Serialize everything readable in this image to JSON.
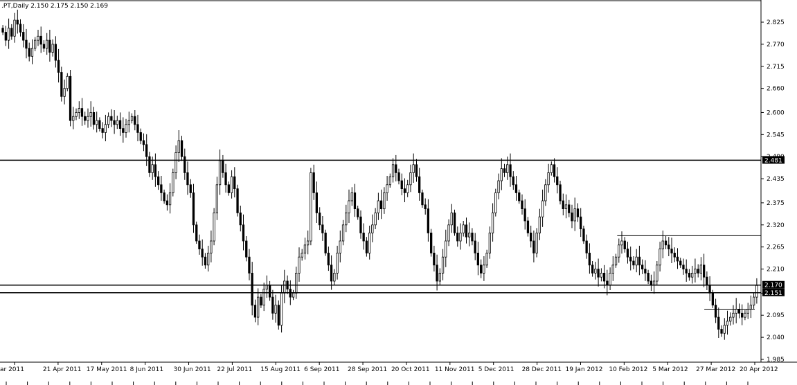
{
  "window": {
    "title": ".PT,Daily  2.150 2.175 2.150 2.169"
  },
  "colors": {
    "background": "#ffffff",
    "candle": "#000000",
    "axis": "#000000",
    "priceTagBackground": "#000000",
    "priceTagText": "#ffffff"
  },
  "chart_data": {
    "type": "candlestick",
    "title": ".PT,Daily",
    "ohlc_header": "2.150 2.175 2.150 2.169",
    "last": {
      "open": 2.15,
      "high": 2.175,
      "low": 2.15,
      "close": 2.169
    },
    "ylim": [
      1.975,
      2.87
    ],
    "y_ticks": [
      "2.825",
      "2.770",
      "2.715",
      "2.660",
      "2.600",
      "2.545",
      "2.490",
      "2.435",
      "2.375",
      "2.320",
      "2.265",
      "2.210",
      "2.150",
      "2.095",
      "2.040",
      "1.985"
    ],
    "x_labels": [
      "ar 2011",
      "21 Apr 2011",
      "17 May 2011",
      "8 Jun 2011",
      "30 Jun 2011",
      "22 Jul 2011",
      "15 Aug 2011",
      "6 Sep 2011",
      "28 Sep 2011",
      "20 Oct 2011",
      "11 Nov 2011",
      "5 Dec 2011",
      "28 Dec 2011",
      "19 Jan 2012",
      "10 Feb 2012",
      "5 Mar 2012",
      "27 Mar 2012",
      "20 Apr 2012"
    ],
    "horizontal_lines": [
      {
        "price": 2.481,
        "label": "2.481",
        "tagged": true
      },
      {
        "price": 2.17,
        "label": "2.170",
        "tagged": true
      },
      {
        "price": 2.151,
        "label": "2.151",
        "tagged": true
      },
      {
        "price": 2.293,
        "label": "",
        "tagged": false,
        "start_date": "10 Feb 2012"
      },
      {
        "price": 2.11,
        "label": "",
        "tagged": false,
        "start_date": "27 Mar 2012",
        "end_date": "20 Apr 2012"
      }
    ],
    "closes": [
      2.8,
      2.78,
      2.81,
      2.79,
      2.83,
      2.82,
      2.8,
      2.78,
      2.76,
      2.74,
      2.76,
      2.78,
      2.79,
      2.77,
      2.76,
      2.78,
      2.75,
      2.77,
      2.73,
      2.7,
      2.64,
      2.66,
      2.69,
      2.58,
      2.59,
      2.6,
      2.61,
      2.59,
      2.58,
      2.59,
      2.6,
      2.57,
      2.58,
      2.56,
      2.55,
      2.57,
      2.59,
      2.58,
      2.57,
      2.58,
      2.56,
      2.55,
      2.57,
      2.58,
      2.59,
      2.57,
      2.55,
      2.53,
      2.52,
      2.49,
      2.45,
      2.47,
      2.44,
      2.42,
      2.4,
      2.38,
      2.37,
      2.4,
      2.45,
      2.5,
      2.53,
      2.49,
      2.45,
      2.42,
      2.4,
      2.32,
      2.28,
      2.26,
      2.24,
      2.22,
      2.25,
      2.28,
      2.35,
      2.42,
      2.48,
      2.45,
      2.42,
      2.4,
      2.44,
      2.41,
      2.35,
      2.32,
      2.28,
      2.24,
      2.2,
      2.12,
      2.09,
      2.14,
      2.12,
      2.16,
      2.17,
      2.14,
      2.1,
      2.12,
      2.07,
      2.15,
      2.18,
      2.16,
      2.14,
      2.15,
      2.2,
      2.24,
      2.25,
      2.27,
      2.28,
      2.45,
      2.4,
      2.35,
      2.32,
      2.3,
      2.25,
      2.22,
      2.18,
      2.2,
      2.25,
      2.28,
      2.32,
      2.35,
      2.38,
      2.4,
      2.36,
      2.34,
      2.3,
      2.28,
      2.25,
      2.3,
      2.32,
      2.35,
      2.38,
      2.36,
      2.4,
      2.42,
      2.44,
      2.47,
      2.45,
      2.43,
      2.41,
      2.4,
      2.42,
      2.45,
      2.47,
      2.44,
      2.4,
      2.37,
      2.36,
      2.3,
      2.25,
      2.22,
      2.18,
      2.2,
      2.24,
      2.28,
      2.32,
      2.35,
      2.3,
      2.28,
      2.3,
      2.32,
      2.29,
      2.3,
      2.28,
      2.25,
      2.22,
      2.2,
      2.22,
      2.25,
      2.3,
      2.35,
      2.4,
      2.43,
      2.46,
      2.45,
      2.47,
      2.44,
      2.42,
      2.4,
      2.38,
      2.36,
      2.33,
      2.3,
      2.28,
      2.25,
      2.3,
      2.34,
      2.38,
      2.42,
      2.45,
      2.47,
      2.44,
      2.42,
      2.38,
      2.36,
      2.37,
      2.35,
      2.33,
      2.36,
      2.34,
      2.31,
      2.28,
      2.25,
      2.22,
      2.2,
      2.21,
      2.19,
      2.2,
      2.18,
      2.17,
      2.2,
      2.22,
      2.24,
      2.27,
      2.28,
      2.26,
      2.24,
      2.23,
      2.22,
      2.24,
      2.22,
      2.21,
      2.2,
      2.18,
      2.17,
      2.18,
      2.22,
      2.26,
      2.28,
      2.27,
      2.26,
      2.25,
      2.24,
      2.23,
      2.22,
      2.21,
      2.2,
      2.19,
      2.2,
      2.21,
      2.2,
      2.22,
      2.19,
      2.17,
      2.15,
      2.12,
      2.09,
      2.06,
      2.05,
      2.07,
      2.08,
      2.09,
      2.1,
      2.11,
      2.1,
      2.09,
      2.1,
      2.11,
      2.12,
      2.14,
      2.169
    ],
    "grid": false,
    "legend": "none"
  }
}
